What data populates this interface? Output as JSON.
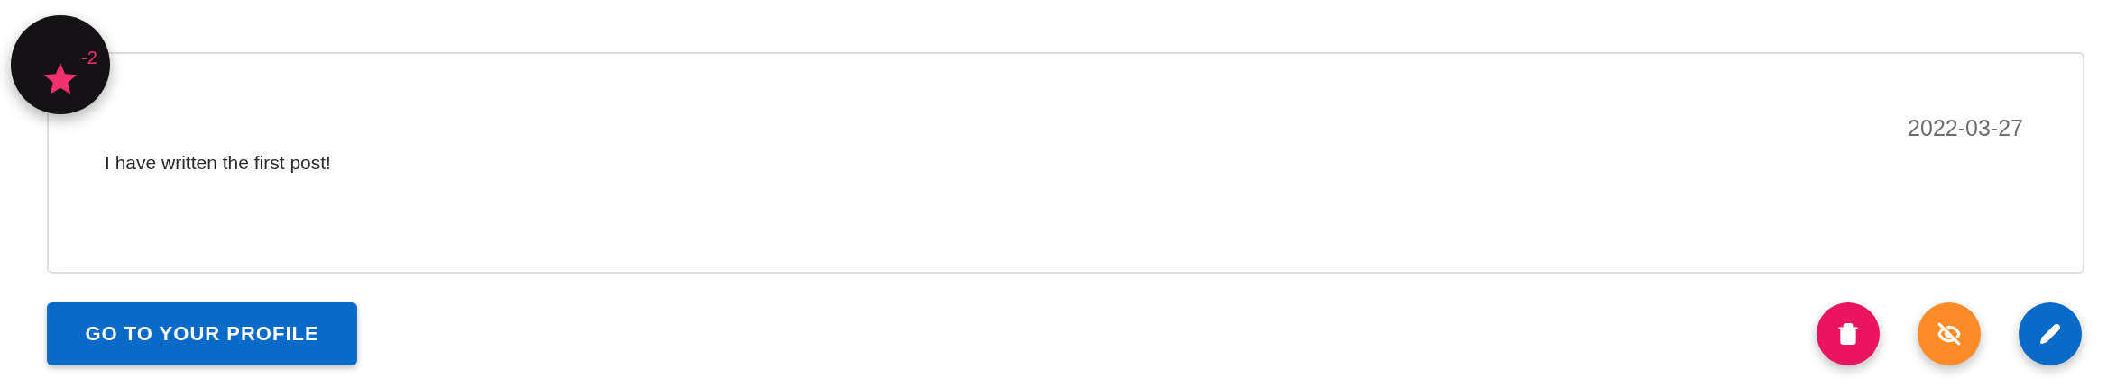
{
  "rating_badge": {
    "value": "-2"
  },
  "post": {
    "date": "2022-03-27",
    "text": "I have written the first post!"
  },
  "profile_button": {
    "label": "GO TO YOUR PROFILE"
  },
  "actions": [
    {
      "kind": "delete",
      "color": "#ea1460"
    },
    {
      "kind": "hide",
      "color": "#fb8c28"
    },
    {
      "kind": "edit",
      "color": "#0a6ac8"
    }
  ]
}
